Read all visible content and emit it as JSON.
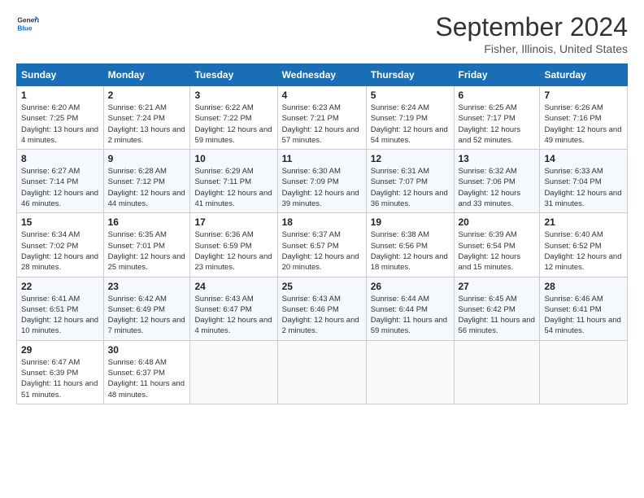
{
  "header": {
    "logo_text_general": "General",
    "logo_text_blue": "Blue",
    "month_title": "September 2024",
    "location": "Fisher, Illinois, United States"
  },
  "days_of_week": [
    "Sunday",
    "Monday",
    "Tuesday",
    "Wednesday",
    "Thursday",
    "Friday",
    "Saturday"
  ],
  "weeks": [
    [
      {
        "day": "1",
        "sunrise": "Sunrise: 6:20 AM",
        "sunset": "Sunset: 7:25 PM",
        "daylight": "Daylight: 13 hours and 4 minutes."
      },
      {
        "day": "2",
        "sunrise": "Sunrise: 6:21 AM",
        "sunset": "Sunset: 7:24 PM",
        "daylight": "Daylight: 13 hours and 2 minutes."
      },
      {
        "day": "3",
        "sunrise": "Sunrise: 6:22 AM",
        "sunset": "Sunset: 7:22 PM",
        "daylight": "Daylight: 12 hours and 59 minutes."
      },
      {
        "day": "4",
        "sunrise": "Sunrise: 6:23 AM",
        "sunset": "Sunset: 7:21 PM",
        "daylight": "Daylight: 12 hours and 57 minutes."
      },
      {
        "day": "5",
        "sunrise": "Sunrise: 6:24 AM",
        "sunset": "Sunset: 7:19 PM",
        "daylight": "Daylight: 12 hours and 54 minutes."
      },
      {
        "day": "6",
        "sunrise": "Sunrise: 6:25 AM",
        "sunset": "Sunset: 7:17 PM",
        "daylight": "Daylight: 12 hours and 52 minutes."
      },
      {
        "day": "7",
        "sunrise": "Sunrise: 6:26 AM",
        "sunset": "Sunset: 7:16 PM",
        "daylight": "Daylight: 12 hours and 49 minutes."
      }
    ],
    [
      {
        "day": "8",
        "sunrise": "Sunrise: 6:27 AM",
        "sunset": "Sunset: 7:14 PM",
        "daylight": "Daylight: 12 hours and 46 minutes."
      },
      {
        "day": "9",
        "sunrise": "Sunrise: 6:28 AM",
        "sunset": "Sunset: 7:12 PM",
        "daylight": "Daylight: 12 hours and 44 minutes."
      },
      {
        "day": "10",
        "sunrise": "Sunrise: 6:29 AM",
        "sunset": "Sunset: 7:11 PM",
        "daylight": "Daylight: 12 hours and 41 minutes."
      },
      {
        "day": "11",
        "sunrise": "Sunrise: 6:30 AM",
        "sunset": "Sunset: 7:09 PM",
        "daylight": "Daylight: 12 hours and 39 minutes."
      },
      {
        "day": "12",
        "sunrise": "Sunrise: 6:31 AM",
        "sunset": "Sunset: 7:07 PM",
        "daylight": "Daylight: 12 hours and 36 minutes."
      },
      {
        "day": "13",
        "sunrise": "Sunrise: 6:32 AM",
        "sunset": "Sunset: 7:06 PM",
        "daylight": "Daylight: 12 hours and 33 minutes."
      },
      {
        "day": "14",
        "sunrise": "Sunrise: 6:33 AM",
        "sunset": "Sunset: 7:04 PM",
        "daylight": "Daylight: 12 hours and 31 minutes."
      }
    ],
    [
      {
        "day": "15",
        "sunrise": "Sunrise: 6:34 AM",
        "sunset": "Sunset: 7:02 PM",
        "daylight": "Daylight: 12 hours and 28 minutes."
      },
      {
        "day": "16",
        "sunrise": "Sunrise: 6:35 AM",
        "sunset": "Sunset: 7:01 PM",
        "daylight": "Daylight: 12 hours and 25 minutes."
      },
      {
        "day": "17",
        "sunrise": "Sunrise: 6:36 AM",
        "sunset": "Sunset: 6:59 PM",
        "daylight": "Daylight: 12 hours and 23 minutes."
      },
      {
        "day": "18",
        "sunrise": "Sunrise: 6:37 AM",
        "sunset": "Sunset: 6:57 PM",
        "daylight": "Daylight: 12 hours and 20 minutes."
      },
      {
        "day": "19",
        "sunrise": "Sunrise: 6:38 AM",
        "sunset": "Sunset: 6:56 PM",
        "daylight": "Daylight: 12 hours and 18 minutes."
      },
      {
        "day": "20",
        "sunrise": "Sunrise: 6:39 AM",
        "sunset": "Sunset: 6:54 PM",
        "daylight": "Daylight: 12 hours and 15 minutes."
      },
      {
        "day": "21",
        "sunrise": "Sunrise: 6:40 AM",
        "sunset": "Sunset: 6:52 PM",
        "daylight": "Daylight: 12 hours and 12 minutes."
      }
    ],
    [
      {
        "day": "22",
        "sunrise": "Sunrise: 6:41 AM",
        "sunset": "Sunset: 6:51 PM",
        "daylight": "Daylight: 12 hours and 10 minutes."
      },
      {
        "day": "23",
        "sunrise": "Sunrise: 6:42 AM",
        "sunset": "Sunset: 6:49 PM",
        "daylight": "Daylight: 12 hours and 7 minutes."
      },
      {
        "day": "24",
        "sunrise": "Sunrise: 6:43 AM",
        "sunset": "Sunset: 6:47 PM",
        "daylight": "Daylight: 12 hours and 4 minutes."
      },
      {
        "day": "25",
        "sunrise": "Sunrise: 6:43 AM",
        "sunset": "Sunset: 6:46 PM",
        "daylight": "Daylight: 12 hours and 2 minutes."
      },
      {
        "day": "26",
        "sunrise": "Sunrise: 6:44 AM",
        "sunset": "Sunset: 6:44 PM",
        "daylight": "Daylight: 11 hours and 59 minutes."
      },
      {
        "day": "27",
        "sunrise": "Sunrise: 6:45 AM",
        "sunset": "Sunset: 6:42 PM",
        "daylight": "Daylight: 11 hours and 56 minutes."
      },
      {
        "day": "28",
        "sunrise": "Sunrise: 6:46 AM",
        "sunset": "Sunset: 6:41 PM",
        "daylight": "Daylight: 11 hours and 54 minutes."
      }
    ],
    [
      {
        "day": "29",
        "sunrise": "Sunrise: 6:47 AM",
        "sunset": "Sunset: 6:39 PM",
        "daylight": "Daylight: 11 hours and 51 minutes."
      },
      {
        "day": "30",
        "sunrise": "Sunrise: 6:48 AM",
        "sunset": "Sunset: 6:37 PM",
        "daylight": "Daylight: 11 hours and 48 minutes."
      },
      null,
      null,
      null,
      null,
      null
    ]
  ]
}
